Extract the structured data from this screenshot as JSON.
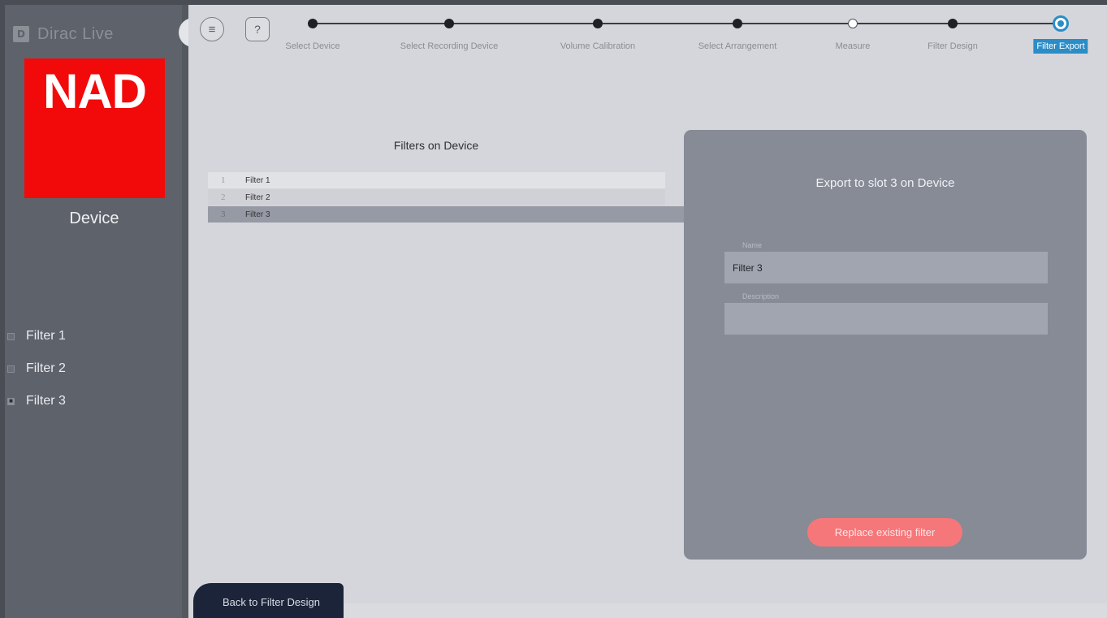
{
  "app": {
    "logo_mark": "D",
    "title": "Dirac Live"
  },
  "sidebar": {
    "device_logo_text": "NAD",
    "device_label": "Device",
    "filters": [
      {
        "label": "Filter 1",
        "checked": false
      },
      {
        "label": "Filter 2",
        "checked": false
      },
      {
        "label": "Filter 3",
        "checked": true
      }
    ],
    "checked_glyph": "■"
  },
  "toolbar": {
    "menu_glyph": "≡",
    "help_glyph": "?"
  },
  "stepper": {
    "steps": [
      {
        "label": "Select Device",
        "state": "done"
      },
      {
        "label": "Select Recording Device",
        "state": "done"
      },
      {
        "label": "Volume Calibration",
        "state": "done"
      },
      {
        "label": "Select Arrangement",
        "state": "done"
      },
      {
        "label": "Measure",
        "state": "open"
      },
      {
        "label": "Filter Design",
        "state": "done"
      },
      {
        "label": "Filter Export",
        "state": "active"
      }
    ],
    "active_color": "#2a8dc7"
  },
  "filters_list": {
    "title": "Filters on Device",
    "rows": [
      {
        "num": "1",
        "name": "Filter 1"
      },
      {
        "num": "2",
        "name": "Filter 2"
      },
      {
        "num": "3",
        "name": "Filter 3"
      }
    ]
  },
  "export_panel": {
    "title": "Export to slot 3 on Device",
    "name_label": "Name",
    "name_value": "Filter 3",
    "description_label": "Description",
    "description_value": "",
    "replace_button": "Replace existing filter",
    "button_color": "#f5777a"
  },
  "footer": {
    "back_button": "Back to Filter Design"
  }
}
